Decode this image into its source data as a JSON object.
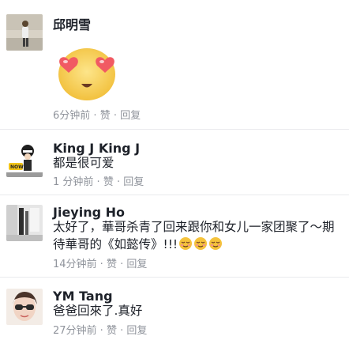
{
  "comments": [
    {
      "author": "邱明雪",
      "text": "",
      "time": "6分钟前",
      "like": "赞",
      "reply": "回复",
      "sticker": "heart-eyes-emoji",
      "avatar": "photo-woman-standing"
    },
    {
      "author": "King J King J",
      "text": "都是很可爱",
      "time": "1 分钟前",
      "like": "赞",
      "reply": "回复",
      "avatar": "cartoon-character-now"
    },
    {
      "author": "Jieying Ho",
      "text_line1": "太好了，華哥杀青了回来跟你和女儿一家团聚了～期",
      "text_line2": "待華哥的《如懿传》!!!",
      "time": "14分钟前",
      "like": "赞",
      "reply": "回复",
      "trailing_emoji": "relieved-face-emoji",
      "avatar": "photo-woman-studio"
    },
    {
      "author": "YM Tang",
      "text": "爸爸回來了.真好",
      "time": "27分钟前",
      "like": "赞",
      "reply": "回复",
      "avatar": "photo-woman-sunglasses"
    }
  ],
  "meta_separator": " · ",
  "colors": {
    "name": "#1d2129",
    "meta": "#90949c",
    "divider": "#e9eaed",
    "emoji_face": "#f7c944",
    "heart": "#f15a63"
  }
}
